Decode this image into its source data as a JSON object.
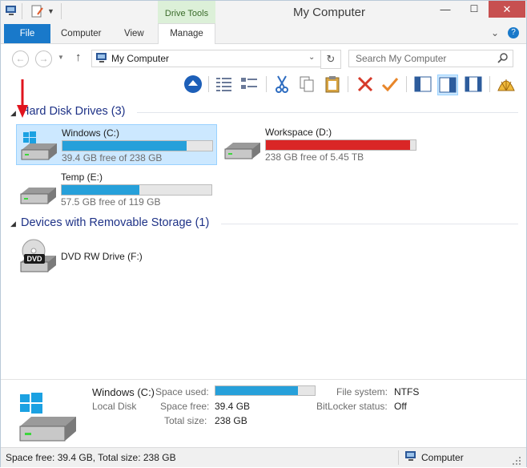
{
  "window": {
    "title": "My Computer",
    "contextual_tab": "Drive Tools",
    "minimize": "—",
    "maximize": "☐",
    "close": "✕"
  },
  "ribbon": {
    "tabs": [
      "File",
      "Computer",
      "View",
      "Manage"
    ]
  },
  "nav": {
    "address": "My Computer",
    "search_placeholder": "Search My Computer"
  },
  "groups": [
    {
      "label": "Hard Disk Drives (3)"
    },
    {
      "label": "Devices with Removable Storage (1)"
    }
  ],
  "drives": [
    {
      "name": "Windows (C:)",
      "free_text": "39.4 GB free of 238 GB",
      "used_fraction": 0.83,
      "color": "#26a0da",
      "selected": true
    },
    {
      "name": "Workspace (D:)",
      "free_text": "238 GB free of 5.45 TB",
      "used_fraction": 0.96,
      "color": "#da2626",
      "selected": false
    },
    {
      "name": "Temp (E:)",
      "free_text": "57.5 GB free of 119 GB",
      "used_fraction": 0.52,
      "color": "#26a0da",
      "selected": false
    }
  ],
  "removable": [
    {
      "name": "DVD RW Drive (F:)",
      "badge": "DVD"
    }
  ],
  "details": {
    "name": "Windows (C:)",
    "type": "Local Disk",
    "space_used_label": "Space used:",
    "space_used_fraction": 0.83,
    "space_free_label": "Space free:",
    "space_free": "39.4 GB",
    "total_size_label": "Total size:",
    "total_size": "238 GB",
    "file_system_label": "File system:",
    "file_system": "NTFS",
    "bitlocker_label": "BitLocker status:",
    "bitlocker": "Off"
  },
  "status": {
    "left": "Space free: 39.4 GB, Total size: 238 GB",
    "right": "Computer"
  },
  "colors": {
    "accent": "#1979ca",
    "selection": "#cce8ff",
    "bar_normal": "#26a0da",
    "bar_full": "#da2626",
    "group_header": "#1e3287"
  }
}
